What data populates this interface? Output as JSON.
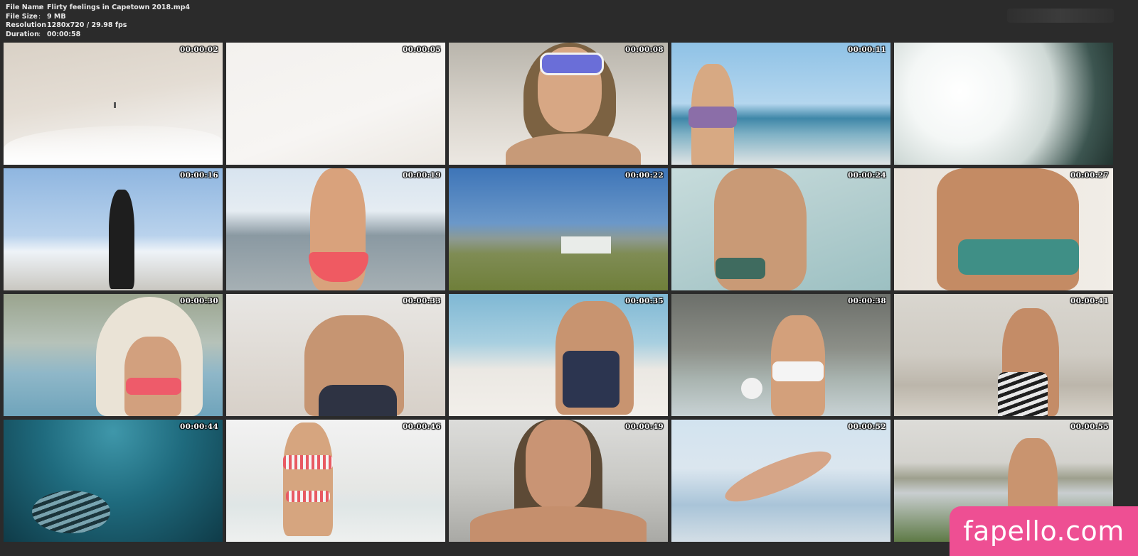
{
  "info": [
    {
      "label": "File Name",
      "value": "Flirty feelings in Capetown 2018.mp4"
    },
    {
      "label": "File Size",
      "value": "9 MB"
    },
    {
      "label": "Resolution",
      "value": "1280x720 / 29.98 fps"
    },
    {
      "label": "Duration",
      "value": "00:00:58"
    }
  ],
  "separator": ":",
  "thumbnails": [
    {
      "time": "00:00:02"
    },
    {
      "time": "00:00:05"
    },
    {
      "time": "00:00:08"
    },
    {
      "time": "00:00:11"
    },
    {
      "time": ""
    },
    {
      "time": "00:00:16"
    },
    {
      "time": "00:00:19"
    },
    {
      "time": "00:00:22"
    },
    {
      "time": "00:00:24"
    },
    {
      "time": "00:00:27"
    },
    {
      "time": "00:00:30"
    },
    {
      "time": "00:00:33"
    },
    {
      "time": "00:00:35"
    },
    {
      "time": "00:00:38"
    },
    {
      "time": "00:00:41"
    },
    {
      "time": "00:00:44"
    },
    {
      "time": "00:00:46"
    },
    {
      "time": "00:00:49"
    },
    {
      "time": "00:00:52"
    },
    {
      "time": "00:00:55"
    }
  ],
  "watermark": "fapello.com",
  "colors": {
    "background": "#2b2b2b",
    "watermark": "#ee4f93",
    "text": "#ffffff"
  }
}
